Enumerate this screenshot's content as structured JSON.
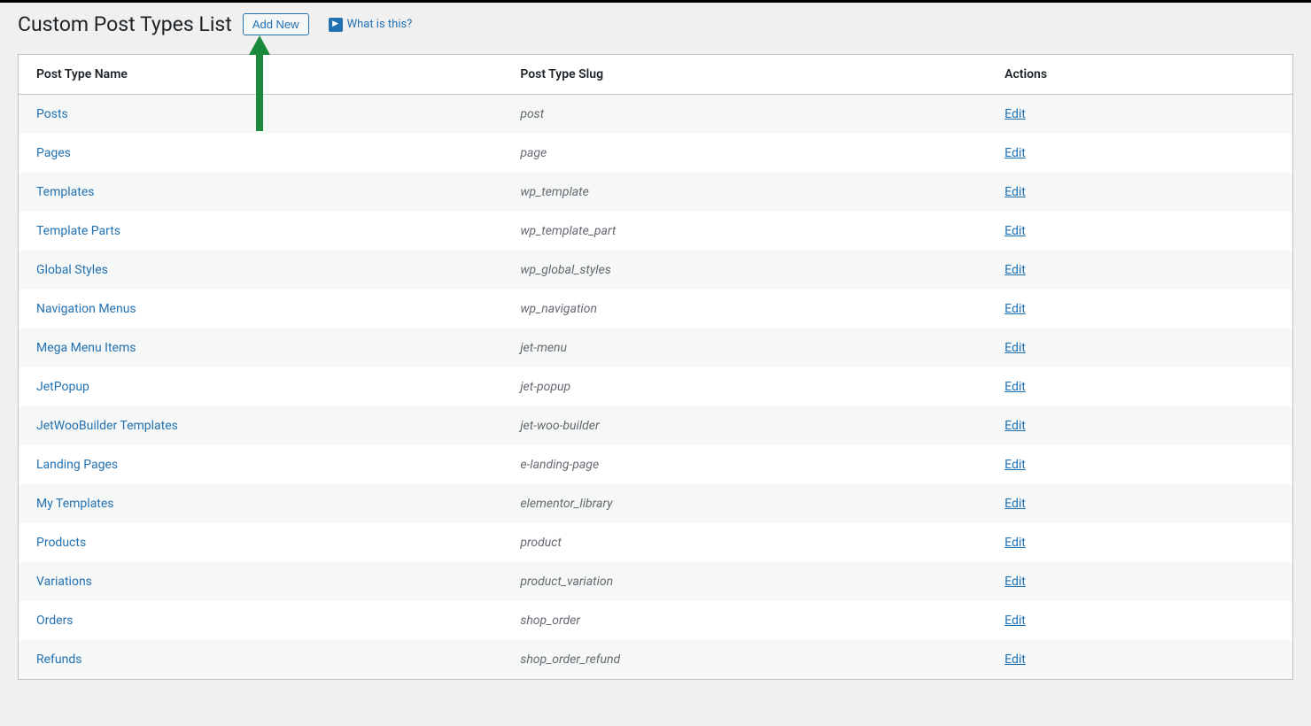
{
  "header": {
    "title": "Custom Post Types List",
    "add_new_label": "Add New",
    "what_is_this_label": "What is this?"
  },
  "table": {
    "columns": {
      "name": "Post Type Name",
      "slug": "Post Type Slug",
      "actions": "Actions"
    },
    "edit_label": "Edit",
    "rows": [
      {
        "name": "Posts",
        "slug": "post"
      },
      {
        "name": "Pages",
        "slug": "page"
      },
      {
        "name": "Templates",
        "slug": "wp_template"
      },
      {
        "name": "Template Parts",
        "slug": "wp_template_part"
      },
      {
        "name": "Global Styles",
        "slug": "wp_global_styles"
      },
      {
        "name": "Navigation Menus",
        "slug": "wp_navigation"
      },
      {
        "name": "Mega Menu Items",
        "slug": "jet-menu"
      },
      {
        "name": "JetPopup",
        "slug": "jet-popup"
      },
      {
        "name": "JetWooBuilder Templates",
        "slug": "jet-woo-builder"
      },
      {
        "name": "Landing Pages",
        "slug": "e-landing-page"
      },
      {
        "name": "My Templates",
        "slug": "elementor_library"
      },
      {
        "name": "Products",
        "slug": "product"
      },
      {
        "name": "Variations",
        "slug": "product_variation"
      },
      {
        "name": "Orders",
        "slug": "shop_order"
      },
      {
        "name": "Refunds",
        "slug": "shop_order_refund"
      }
    ]
  },
  "colors": {
    "link": "#2271b1",
    "arrow": "#1a8a3a"
  }
}
